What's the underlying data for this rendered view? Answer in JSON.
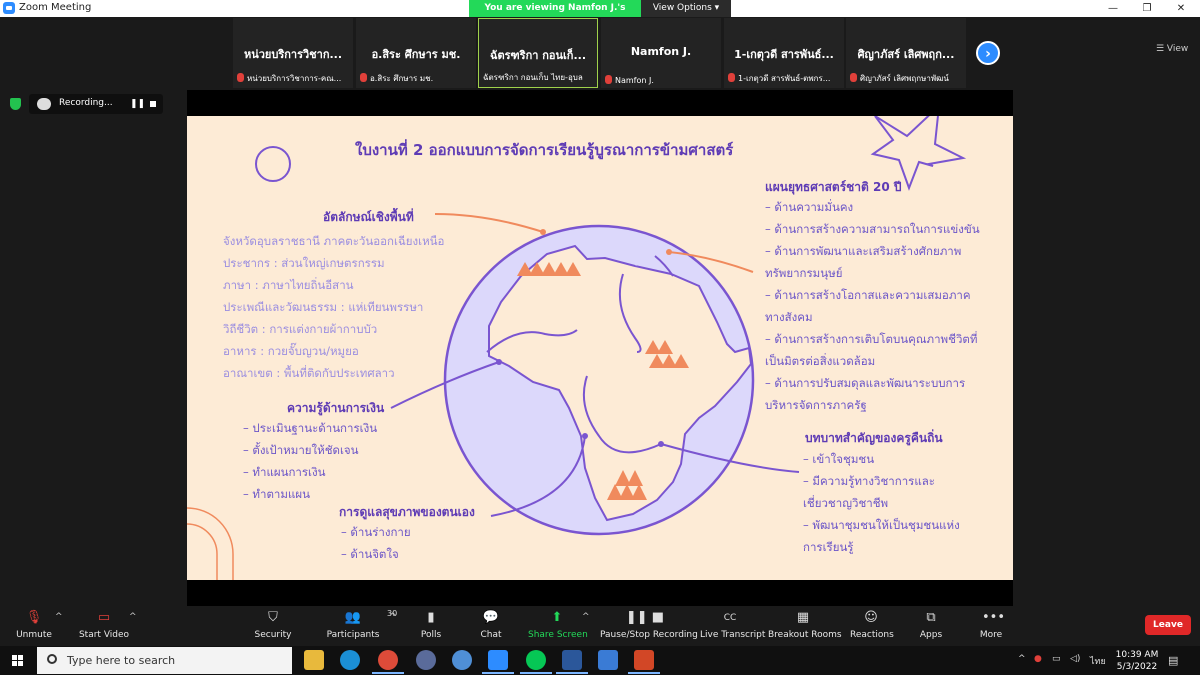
{
  "window": {
    "title": "Zoom Meeting",
    "controls": [
      "—",
      "❐",
      "✕"
    ]
  },
  "share_banner": {
    "text": "You are viewing Namfon J.'s screen",
    "options": "View Options ▾"
  },
  "gallery": {
    "view_label": "☰ View",
    "participants": [
      {
        "name": "หน่วยบริการวิชาก...",
        "sub": "หน่วยบริการวิชาการ-คณ..."
      },
      {
        "name": "อ.สิระ ศึกษาร มช.",
        "sub": "อ.สิระ ศึกษาร มช."
      },
      {
        "name": "ฉัตรฑริกา กอนเก็...",
        "sub": "ฉัตรฑริกา กอนเก็บ ไทย-อุบล"
      },
      {
        "name": "Namfon J.",
        "sub": "Namfon J."
      },
      {
        "name": "1-เกตุวดี สารพันธ์...",
        "sub": "1-เกตุวดี สารพันธ์-ตพกร..."
      },
      {
        "name": "ศิญาภัสร์ เลิศพฤก...",
        "sub": "ศิญาภัสร์ เลิศพฤกษาพัฒน์"
      }
    ]
  },
  "recording": {
    "label": "Recording..."
  },
  "slide": {
    "title": "ใบงานที่ 2 ออกแบบการจัดการเรียนรู้บูรณาการข้ามศาสตร์",
    "local_identity": {
      "heading": "อัตลักษณ์เชิงพื้นที่",
      "lines": [
        "จังหวัดอุบลราชธานี ภาคตะวันออกเฉียงเหนือ",
        "ประชากร : ส่วนใหญ่เกษตรกรรม",
        "ภาษา : ภาษาไทยถิ่นอีสาน",
        "ประเพณีและวัฒนธรรม : แห่เทียนพรรษา",
        "วิถีชีวิต : การแต่งกายผ้ากาบบัว",
        "อาหาร : กวยจั๊บญวน/หมูยอ",
        "อาณาเขต : พื้นที่ติดกับประเทศลาว"
      ]
    },
    "finance": {
      "heading": "ความรู้ด้านการเงิน",
      "lines": [
        "– ประเมินฐานะด้านการเงิน",
        "– ตั้งเป้าหมายให้ชัดเจน",
        "– ทำแผนการเงิน",
        "– ทำตามแผน"
      ]
    },
    "health": {
      "heading": "การดูแลสุขภาพของตนเอง",
      "lines": [
        "–     ด้านร่างกาย",
        "–     ด้านจิตใจ"
      ]
    },
    "strategy": {
      "heading": "แผนยุทธศาสตร์ชาติ 20 ปี",
      "lines": [
        "– ด้านความมั่นคง",
        "– ด้านการสร้างความสามารถในการแข่งขัน",
        "– ด้านการพัฒนาและเสริมสร้างศักยภาพ",
        "ทรัพยากรมนุษย์",
        "– ด้านการสร้างโอกาสและความเสมอภาค",
        "ทางสังคม",
        "– ด้านการสร้างการเติบโตบนคุณภาพชีวิตที่",
        "เป็นมิตรต่อสิ่งแวดล้อม",
        "– ด้านการปรับสมดุลและพัฒนาระบบการ",
        "บริหารจัดการภาครัฐ"
      ]
    },
    "teacher_role": {
      "heading": "บทบาทสำคัญของครูคืนถิ่น",
      "lines": [
        "–          เข้าใจชุมชน",
        "–          มีความรู้ทางวิชาการและ",
        "            เชี่ยวชาญวิชาชีพ",
        "–          พัฒนาชุมชนให้เป็นชุมชนแห่ง",
        "            การเรียนรู้"
      ]
    }
  },
  "toolbar": {
    "unmute": "Unmute",
    "start_video": "Start Video",
    "security": "Security",
    "participants": "Participants",
    "participants_count": "30",
    "polls": "Polls",
    "chat": "Chat",
    "share_screen": "Share Screen",
    "pause_stop_recording": "Pause/Stop Recording",
    "live_transcript": "Live Transcript",
    "breakout_rooms": "Breakout Rooms",
    "reactions": "Reactions",
    "apps": "Apps",
    "more": "More",
    "leave": "Leave"
  },
  "taskbar": {
    "search_placeholder": "Type here to search",
    "language": "ไทย",
    "time": "10:39 AM",
    "date": "5/3/2022"
  },
  "colors": {
    "slide_bg": "#fdebd6",
    "purple": "#5e3bb5",
    "globe_fill": "#dcd8fb",
    "orange": "#f08a5d",
    "zoom_blue": "#2d8cff",
    "share_green": "#23d959",
    "leave_red": "#e02828"
  }
}
